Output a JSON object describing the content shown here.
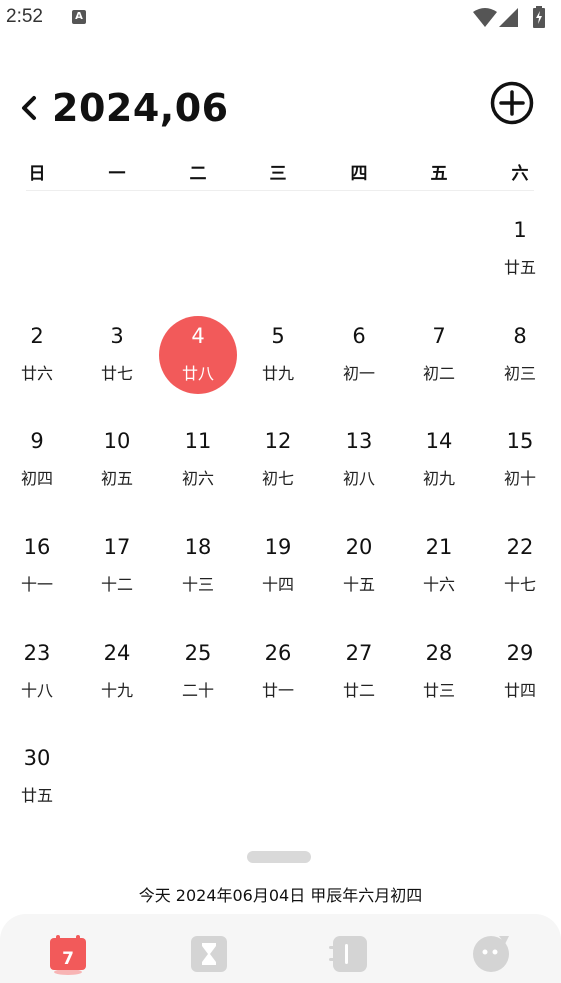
{
  "status": {
    "time": "2:52",
    "notification_glyph": "A"
  },
  "header": {
    "title": "2024,06"
  },
  "weekdays": [
    "日",
    "一",
    "二",
    "三",
    "四",
    "五",
    "六"
  ],
  "days": [
    {
      "n": "1",
      "l": "廿五"
    },
    {
      "n": "2",
      "l": "廿六"
    },
    {
      "n": "3",
      "l": "廿七"
    },
    {
      "n": "4",
      "l": "廿八"
    },
    {
      "n": "5",
      "l": "廿九"
    },
    {
      "n": "6",
      "l": "初一"
    },
    {
      "n": "7",
      "l": "初二"
    },
    {
      "n": "8",
      "l": "初三"
    },
    {
      "n": "9",
      "l": "初四"
    },
    {
      "n": "10",
      "l": "初五"
    },
    {
      "n": "11",
      "l": "初六"
    },
    {
      "n": "12",
      "l": "初七"
    },
    {
      "n": "13",
      "l": "初八"
    },
    {
      "n": "14",
      "l": "初九"
    },
    {
      "n": "15",
      "l": "初十"
    },
    {
      "n": "16",
      "l": "十一"
    },
    {
      "n": "17",
      "l": "十二"
    },
    {
      "n": "18",
      "l": "十三"
    },
    {
      "n": "19",
      "l": "十四"
    },
    {
      "n": "20",
      "l": "十五"
    },
    {
      "n": "21",
      "l": "十六"
    },
    {
      "n": "22",
      "l": "十七"
    },
    {
      "n": "23",
      "l": "十八"
    },
    {
      "n": "24",
      "l": "十九"
    },
    {
      "n": "25",
      "l": "二十"
    },
    {
      "n": "26",
      "l": "廿一"
    },
    {
      "n": "27",
      "l": "廿二"
    },
    {
      "n": "28",
      "l": "廿三"
    },
    {
      "n": "29",
      "l": "廿四"
    },
    {
      "n": "30",
      "l": "廿五"
    }
  ],
  "selected_day": "4",
  "today_info": "今天  2024年06月04日  甲辰年六月初四",
  "nav": {
    "calendar_badge": "7",
    "items": [
      "calendar-icon",
      "hourglass-icon",
      "notebook-icon",
      "chat-icon"
    ]
  },
  "colors": {
    "accent": "#f25a5a",
    "nav_bg": "#f6f6f6",
    "icon_gray": "#d4d4d4"
  }
}
